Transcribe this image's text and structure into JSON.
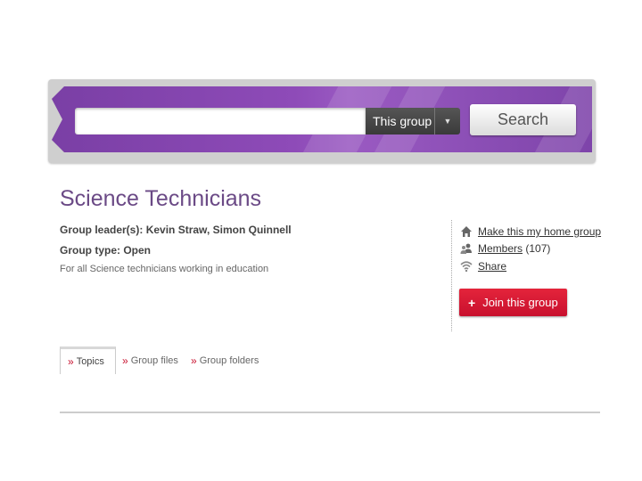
{
  "search": {
    "input_value": "",
    "input_placeholder": "",
    "scope_selected": "This group",
    "button_label": "Search"
  },
  "group": {
    "title": "Science Technicians",
    "leaders_label": "Group leader(s):",
    "leaders_value": "Kevin Straw, Simon Quinnell",
    "type_label": "Group type:",
    "type_value": "Open",
    "description": "For all Science technicians working in education"
  },
  "side": {
    "home_link": "Make this my home group",
    "members_label": "Members",
    "members_count": "(107)",
    "share_link": "Share",
    "join_button": "Join this group",
    "join_symbol": "+"
  },
  "tabs": [
    {
      "label": "Topics",
      "active": true
    },
    {
      "label": "Group files",
      "active": false
    },
    {
      "label": "Group folders",
      "active": false
    }
  ],
  "colors": {
    "banner_purple": "#8e4bb8",
    "title_purple": "#6b4a86",
    "join_red": "#d91a33",
    "chevron_red": "#c8102e"
  },
  "icons": {
    "home": "home-icon",
    "members": "people-icon",
    "share": "wifi-share-icon",
    "scope_dropdown": "caret-down-icon",
    "tab_chevron": "double-chevron-right-icon"
  }
}
